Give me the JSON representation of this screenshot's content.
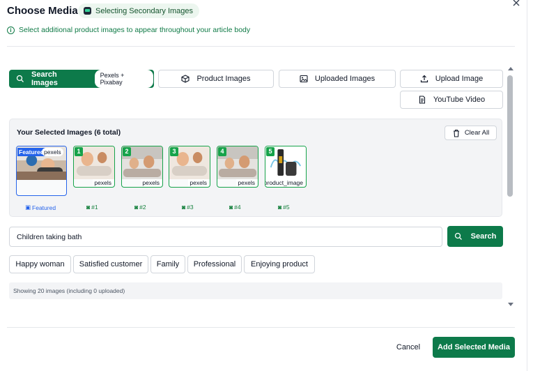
{
  "header": {
    "title": "Choose Media",
    "mode_pill": "Selecting Secondary Images",
    "subtitle": "Select additional product images to appear throughout your article body",
    "close_icon": "close-icon"
  },
  "tabs": [
    {
      "label": "Search Images",
      "badge": "Pexels + Pixabay",
      "icon": "search-icon",
      "active": true
    },
    {
      "label": "Product Images",
      "icon": "box-icon",
      "active": false
    },
    {
      "label": "Uploaded Images",
      "icon": "image-icon",
      "active": false
    },
    {
      "label": "Upload Image",
      "icon": "upload-icon",
      "active": false
    },
    {
      "label": "YouTube Video",
      "icon": "document-icon",
      "active": false
    }
  ],
  "selected": {
    "title": "Your Selected Images (6 total)",
    "clear_label": "Clear All",
    "items": [
      {
        "badge": "Featured",
        "source": "pexels",
        "caption": "Featured"
      },
      {
        "badge": "1",
        "source": "pexels",
        "caption": "#1"
      },
      {
        "badge": "2",
        "source": "pexels",
        "caption": "#2"
      },
      {
        "badge": "3",
        "source": "pexels",
        "caption": "#3"
      },
      {
        "badge": "4",
        "source": "pexels",
        "caption": "#4"
      },
      {
        "badge": "5",
        "source": "product_image",
        "caption": "#5"
      }
    ]
  },
  "search": {
    "value": "Children taking bath",
    "button_label": "Search"
  },
  "suggestions": [
    "Happy woman",
    "Satisfied customer",
    "Family",
    "Professional",
    "Enjoying product"
  ],
  "status": "Showing 20 images (including 0 uploaded)",
  "footer": {
    "cancel_label": "Cancel",
    "submit_label": "Add Selected Media"
  },
  "colors": {
    "primary": "#0d7a4a",
    "featured": "#2563eb",
    "selected_border": "#16a34a"
  }
}
